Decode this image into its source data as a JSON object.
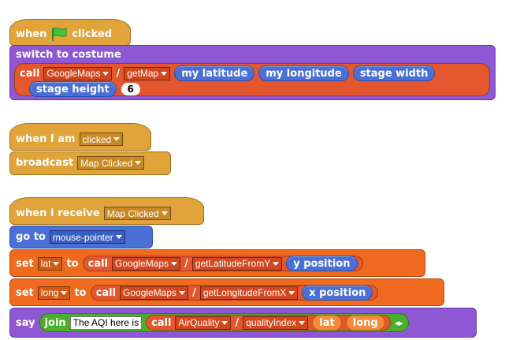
{
  "script1": {
    "hat_when": "when",
    "hat_clicked": "clicked",
    "switch_label": "switch to costume",
    "call": "call",
    "lib": "GoogleMaps",
    "slash": "/",
    "fn": "getMap",
    "arg1": "my latitude",
    "arg2": "my longitude",
    "arg3": "stage width",
    "arg4": "stage height",
    "arg5": "6"
  },
  "script2": {
    "hat": "when I am",
    "trigger": "clicked",
    "broadcast": "broadcast",
    "message": "Map Clicked"
  },
  "script3": {
    "hat": "when I receive",
    "message": "Map Clicked",
    "goto": "go to",
    "goto_target": "mouse-pointer",
    "set1": "set",
    "var1": "lat",
    "to1": "to",
    "call1": "call",
    "lib1": "GoogleMaps",
    "slash1": "/",
    "fn1": "getLatitudeFromY",
    "arg1": "y position",
    "set2": "set",
    "var2": "long",
    "to2": "to",
    "call2": "call",
    "lib2": "GoogleMaps",
    "slash2": "/",
    "fn2": "getLongitudeFromX",
    "arg2": "x position",
    "say": "say",
    "join": "join",
    "text": "The AQI here is",
    "call3": "call",
    "lib3": "AirQuality",
    "slash3": "/",
    "fn3": "qualityIndex",
    "p1": "lat",
    "p2": "long",
    "arrows": "◂▸"
  },
  "colors": {
    "control": "#e0a43a",
    "looks": "#8e57d4",
    "motion": "#4a6fd6",
    "variables": "#f06b1f",
    "call": "#e4572e",
    "operators": "#4caf2b",
    "flag": "#3ec53e"
  }
}
